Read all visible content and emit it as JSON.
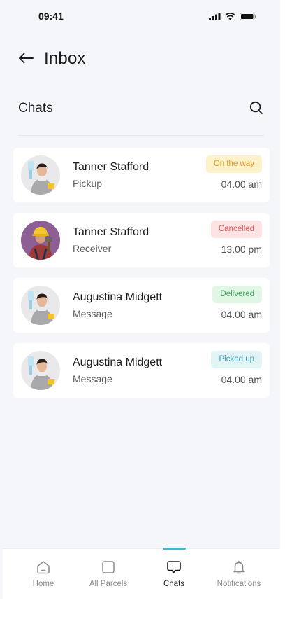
{
  "status_bar": {
    "time": "09:41"
  },
  "header": {
    "back_icon": "arrow-left-icon",
    "title": "Inbox"
  },
  "section": {
    "title": "Chats",
    "search_icon": "search-icon"
  },
  "chats": [
    {
      "name": "Tanner Stafford",
      "subtitle": "Pickup",
      "status": "On the way",
      "status_bg": "#fdf1c9",
      "status_color": "#d39a1c",
      "time": "04.00 am",
      "avatar": "woman-cleaner-avatar"
    },
    {
      "name": "Tanner Stafford",
      "subtitle": "Receiver",
      "status": "Cancelled",
      "status_bg": "#fde3e3",
      "status_color": "#e05a5a",
      "time": "13.00 pm",
      "avatar": "construction-worker-avatar"
    },
    {
      "name": "Augustina Midgett",
      "subtitle": "Message",
      "status": "Delivered",
      "status_bg": "#e2f6e6",
      "status_color": "#3ea85a",
      "time": "04.00 am",
      "avatar": "woman-cleaner-avatar"
    },
    {
      "name": "Augustina Midgett",
      "subtitle": "Message",
      "status": "Picked up",
      "status_bg": "#e2f4f6",
      "status_color": "#3c9cb0",
      "time": "04.00 am",
      "avatar": "woman-cleaner-avatar"
    }
  ],
  "bottom_nav": {
    "active_color": "#4db3c8",
    "items": [
      {
        "label": "Home",
        "icon": "home-icon",
        "active": false
      },
      {
        "label": "All Parcels",
        "icon": "parcel-box-icon",
        "active": false
      },
      {
        "label": "Chats",
        "icon": "chat-bubble-icon",
        "active": true
      },
      {
        "label": "Notifications",
        "icon": "bell-icon",
        "active": false
      }
    ]
  }
}
